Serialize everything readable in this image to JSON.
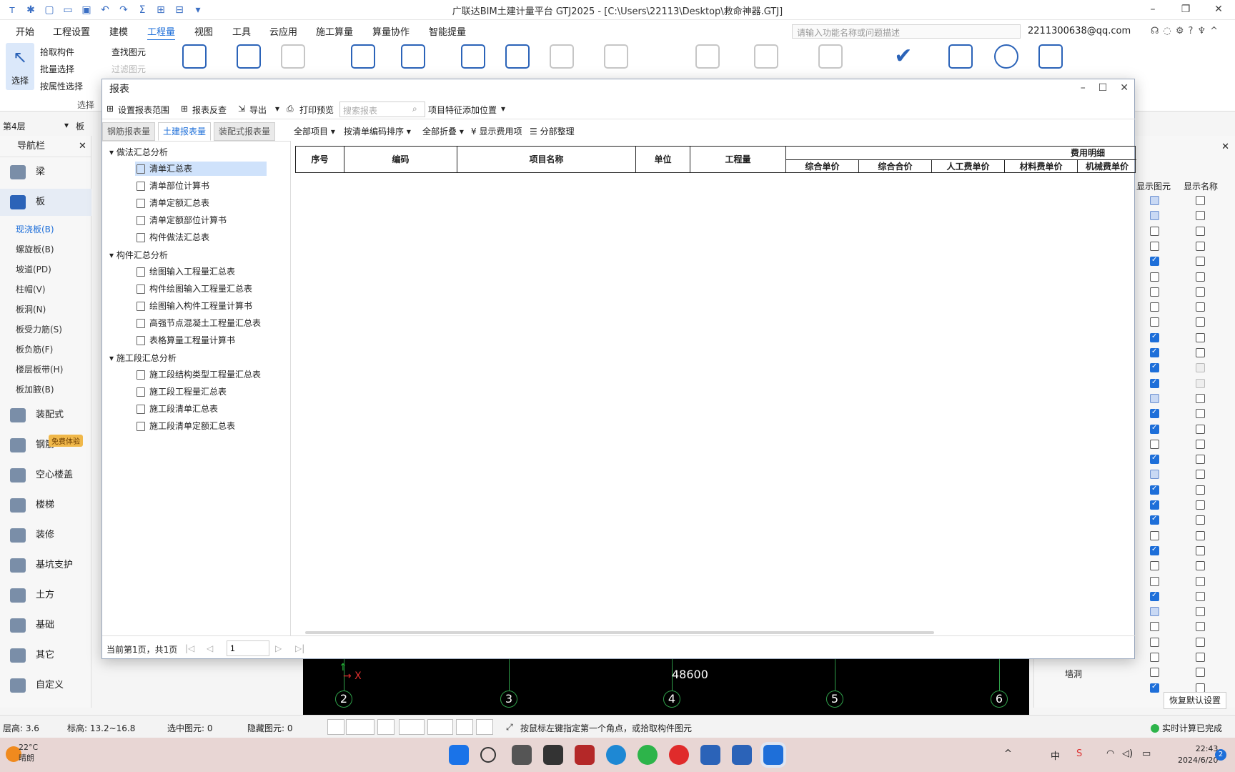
{
  "app": {
    "title": "广联达BIM土建计量平台 GTJ2025 - [C:\\Users\\22113\\Desktop\\救命神器.GTJ]"
  },
  "menu": [
    "开始",
    "工程设置",
    "建模",
    "工程量",
    "视图",
    "工具",
    "云应用",
    "施工算量",
    "算量协作",
    "智能提量"
  ],
  "menu_active": "工程量",
  "search": {
    "placeholder": "请输入功能名称或问题描述"
  },
  "user": "2211300638@qq.com",
  "ribbon": {
    "select": "选择",
    "pick": "拾取构件",
    "batch": "批量选择",
    "by_attr": "按属性选择",
    "find": "查找图元",
    "filter": "过滤图元",
    "group_select": "选择"
  },
  "floor": {
    "value": "第4层",
    "type": "板"
  },
  "nav": {
    "title": "导航栏",
    "categories": [
      {
        "label": "梁"
      },
      {
        "label": "板"
      },
      {
        "label": "装配式"
      },
      {
        "label": "钢筋"
      },
      {
        "label": "空心楼盖"
      },
      {
        "label": "楼梯"
      },
      {
        "label": "装修"
      },
      {
        "label": "基坑支护"
      },
      {
        "label": "土方"
      },
      {
        "label": "基础"
      },
      {
        "label": "其它"
      },
      {
        "label": "自定义"
      }
    ],
    "sub": [
      "现浇板(B)",
      "螺旋板(B)",
      "坡道(PD)",
      "柱帽(V)",
      "板洞(N)",
      "板受力筋(S)",
      "板负筋(F)",
      "楼层板带(H)",
      "板加腋(B)"
    ],
    "free_badge": "免费体验"
  },
  "dialog": {
    "title": "报表",
    "toolbar": {
      "set_range": "设置报表范围",
      "reverse_check": "报表反查",
      "export": "导出",
      "print_preview": "打印预览",
      "search_placeholder": "搜索报表",
      "feature_pos": "项目特征添加位置"
    },
    "tabs": [
      "钢筋报表量",
      "土建报表量",
      "装配式报表量"
    ],
    "active_tab": "土建报表量",
    "tree": [
      {
        "group": "做法汇总分析",
        "items": [
          "清单汇总表",
          "清单部位计算书",
          "清单定额汇总表",
          "清单定额部位计算书",
          "构件做法汇总表"
        ]
      },
      {
        "group": "构件汇总分析",
        "items": [
          "绘图输入工程量汇总表",
          "构件绘图输入工程量汇总表",
          "绘图输入构件工程量计算书",
          "高强节点混凝土工程量汇总表",
          "表格算量工程量计算书"
        ]
      },
      {
        "group": "施工段汇总分析",
        "items": [
          "施工段结构类型工程量汇总表",
          "施工段工程量汇总表",
          "施工段清单汇总表",
          "施工段清单定额汇总表"
        ]
      }
    ],
    "selected_item": "清单汇总表",
    "filters": {
      "all_items": "全部项目",
      "sort": "按清单编码排序",
      "fold": "全部折叠",
      "show_fee": "显示费用项",
      "subdivide": "分部整理"
    },
    "table": {
      "headers": [
        "序号",
        "编码",
        "项目名称",
        "单位",
        "工程量"
      ],
      "fee_group": "费用明细",
      "fee_cols": [
        "综合单价",
        "综合合价",
        "人工费单价",
        "材料费单价",
        "机械费单价"
      ]
    },
    "pager": {
      "text": "当前第1页，共1页",
      "page": "1"
    }
  },
  "right_panel": {
    "col_show_elem": "显示图元",
    "col_show_name": "显示名称",
    "partial_labels": [
      "墙洞"
    ],
    "restore": "恢复默认设置",
    "show_elem_states": [
      "part",
      "part",
      "off",
      "off",
      "on",
      "off",
      "off",
      "off",
      "off",
      "on",
      "on",
      "on",
      "on",
      "part",
      "on",
      "on",
      "off",
      "on",
      "part",
      "on",
      "on",
      "on",
      "off",
      "on",
      "off",
      "off",
      "on",
      "part",
      "off",
      "off",
      "off",
      "off",
      "on"
    ],
    "show_name_states": [
      "off",
      "off",
      "off",
      "off",
      "off",
      "off",
      "off",
      "off",
      "off",
      "off",
      "off",
      "dim",
      "dim",
      "off",
      "off",
      "off",
      "off",
      "off",
      "off",
      "off",
      "off",
      "off",
      "off",
      "off",
      "off",
      "off",
      "off",
      "off",
      "off",
      "off",
      "off",
      "off",
      "off"
    ]
  },
  "canvas": {
    "dimension": "48600",
    "axes": [
      "2",
      "3",
      "4",
      "5",
      "6"
    ]
  },
  "status": {
    "floor_height": "层高:  3.6",
    "elevation": "标高:  13.2~16.8",
    "selected": "选中图元: 0",
    "hidden": "隐藏图元: 0",
    "hint": "按鼠标左键指定第一个角点，或拾取构件图元",
    "calc": "实时计算已完成"
  },
  "taskbar": {
    "temp": "22°C",
    "weather": "晴朗",
    "ime": "中",
    "time": "22:43",
    "date": "2024/6/20",
    "notif": "2"
  }
}
